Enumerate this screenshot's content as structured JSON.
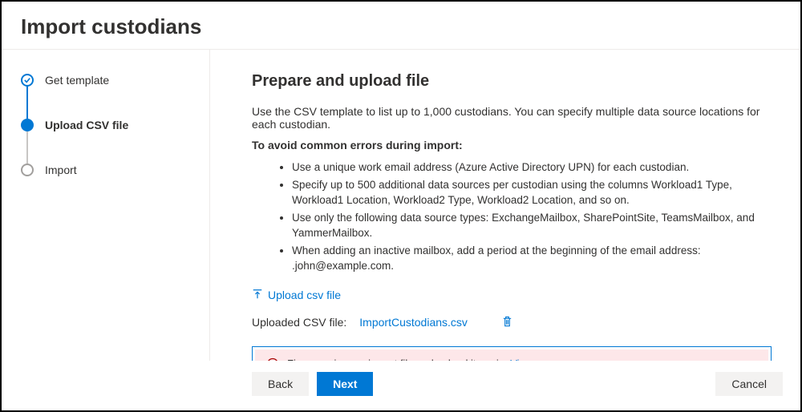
{
  "title": "Import custodians",
  "steps": {
    "s1": "Get template",
    "s2": "Upload CSV file",
    "s3": "Import"
  },
  "main": {
    "heading": "Prepare and upload file",
    "description": "Use the CSV template to list up to 1,000 custodians. You can specify multiple data source locations for each custodian.",
    "subheading": "To avoid common errors during import:",
    "bullets": {
      "b1": "Use a unique work email address (Azure Active Directory UPN) for each custodian.",
      "b2": "Specify up to 500 additional data sources per custodian using the columns Workload1 Type, Workload1 Location, Workload2 Type, Workload2 Location, and so on.",
      "b3": "Use only the following data source types: ExchangeMailbox, SharePointSite, TeamsMailbox, and YammerMailbox.",
      "b4": "When adding an inactive mailbox, add a period at the beginning of the email address: .john@example.com."
    },
    "upload_link": "Upload csv file",
    "file_label": "Uploaded CSV file:",
    "file_name": "ImportCustodians.csv",
    "alert_text": "Fix errors in your import file and upload it again. ",
    "alert_link": "View errors"
  },
  "footer": {
    "back": "Back",
    "next": "Next",
    "cancel": "Cancel"
  }
}
